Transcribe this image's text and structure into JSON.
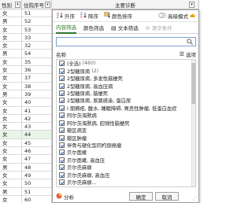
{
  "sheet": {
    "headers": [
      {
        "label": "性别",
        "arrow": "▾"
      },
      {
        "label": "住院序号",
        "arrow": "▾"
      },
      {
        "label": "主要诊断",
        "arrow": "▾"
      }
    ],
    "rows": [
      {
        "gender": "女",
        "num": "51"
      },
      {
        "gender": "男",
        "num": "52"
      },
      {
        "gender": "女",
        "num": "53"
      },
      {
        "gender": "女",
        "num": "33"
      },
      {
        "gender": "女",
        "num": "32"
      },
      {
        "gender": "男",
        "num": "54"
      },
      {
        "gender": "女",
        "num": "35"
      },
      {
        "gender": "女",
        "num": "36"
      },
      {
        "gender": "女",
        "num": "37"
      },
      {
        "gender": "女",
        "num": "38"
      },
      {
        "gender": "男",
        "num": "39"
      },
      {
        "gender": "女",
        "num": "40"
      },
      {
        "gender": "女",
        "num": "41"
      },
      {
        "gender": "女",
        "num": "42"
      },
      {
        "gender": "女",
        "num": "43"
      },
      {
        "gender": "女",
        "num": "44"
      },
      {
        "gender": "女",
        "num": "45"
      },
      {
        "gender": "女",
        "num": "46"
      },
      {
        "gender": "女",
        "num": "47"
      },
      {
        "gender": "男",
        "num": "48"
      },
      {
        "gender": "女",
        "num": "49"
      },
      {
        "gender": "女",
        "num": "50"
      },
      {
        "gender": "男",
        "num": "51"
      },
      {
        "gender": "女",
        "num": "60"
      }
    ]
  },
  "popup": {
    "sort": {
      "asc": "升序",
      "desc": "降序",
      "color": "颜色排序",
      "advanced": "高级模式"
    },
    "tabs": [
      "内容筛选",
      "颜色筛选",
      "文本筛选",
      "清空条件"
    ],
    "search_placeholder": "",
    "list_header": {
      "name": "名称",
      "options": "选项"
    },
    "items": [
      {
        "label": "(全选)",
        "count": "(460)"
      },
      {
        "label": "2型糖尿病",
        "count": "(2)"
      },
      {
        "label": "2型糖尿病, 多发性脑梗死",
        "count": ""
      },
      {
        "label": "2型糖尿病, 高血压病",
        "count": ""
      },
      {
        "label": "2型糖尿病, 脑梗死",
        "count": ""
      },
      {
        "label": "2型糖尿病, 尿路感染, 蛋白尿",
        "count": ""
      },
      {
        "label": "I 期褥疮, 腹水, 睡眠障碍, 胃恶性肿瘤, 低蛋白血症",
        "count": ""
      },
      {
        "label": "阿尔茨海默病",
        "count": ""
      },
      {
        "label": "阿尔茨海默病, 腔隙性脑梗死",
        "count": ""
      },
      {
        "label": "鞍区病变",
        "count": ""
      },
      {
        "label": "鞍区肿瘤",
        "count": ""
      },
      {
        "label": "伴骨与硬化型同杓倒癌瘤",
        "count": ""
      },
      {
        "label": "贝尔面瘫",
        "count": ""
      },
      {
        "label": "贝尔面瘫, 高血压",
        "count": ""
      },
      {
        "label": "贝尔氏麻痹",
        "count": ""
      },
      {
        "label": "贝尔氏麻痹, 高血压",
        "count": ""
      },
      {
        "label": "贝尔氏麻痹...",
        "count": ""
      }
    ],
    "footer": {
      "analyze": "分析",
      "ok": "确定",
      "cancel": "取消"
    }
  }
}
